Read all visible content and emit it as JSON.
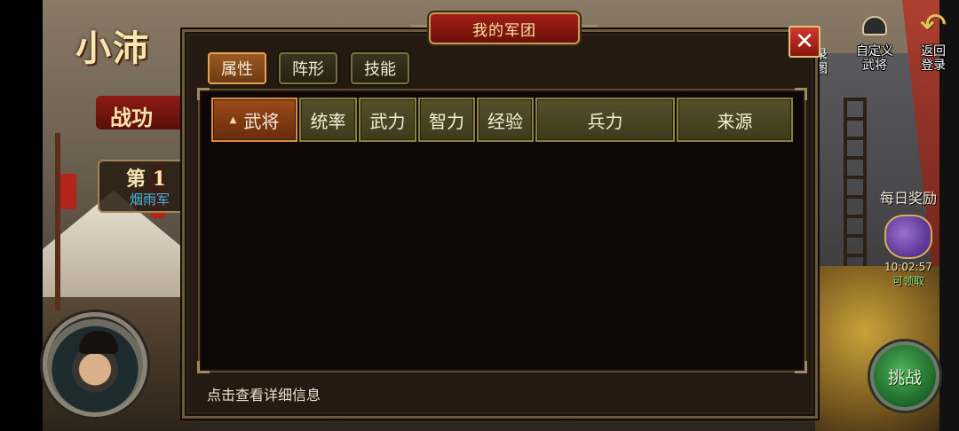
{
  "game": {
    "title": "小沛",
    "banner": "战功",
    "rank": "第 1",
    "guild": "烟雨军"
  },
  "top_right": {
    "custom_general": "自定义\n武将",
    "custom_general_lines": [
      "自定义",
      "武将"
    ],
    "return_login_lines": [
      "返回",
      "登录"
    ],
    "cut_label_lines": [
      "录",
      "图"
    ]
  },
  "daily_reward": {
    "label": "每日奖励",
    "timer": "10:02:57",
    "status": "可领取"
  },
  "challenge_label": "挑战",
  "modal": {
    "title": "我的军团",
    "close_label": "✕",
    "tabs": [
      {
        "label": "属性",
        "active": true
      },
      {
        "label": "阵形",
        "active": false
      },
      {
        "label": "技能",
        "active": false
      }
    ],
    "columns": [
      {
        "label": "武将",
        "active": true
      },
      {
        "label": "统率",
        "active": false
      },
      {
        "label": "武力",
        "active": false
      },
      {
        "label": "智力",
        "active": false
      },
      {
        "label": "经验",
        "active": false
      },
      {
        "label": "兵力",
        "active": false
      },
      {
        "label": "来源",
        "active": false
      }
    ],
    "sort_indicator": "▲",
    "hint": "点击查看详细信息"
  },
  "colors": {
    "active_orange": "#9a5a22",
    "header_olive": "#56502a",
    "title_red": "#a31f16",
    "close_red": "#d0382c",
    "challenge_green": "#4fb15a"
  },
  "icons": [
    "close-icon",
    "helmet-icon",
    "back-arrow-icon",
    "reward-bag-icon",
    "sort-up-icon"
  ]
}
